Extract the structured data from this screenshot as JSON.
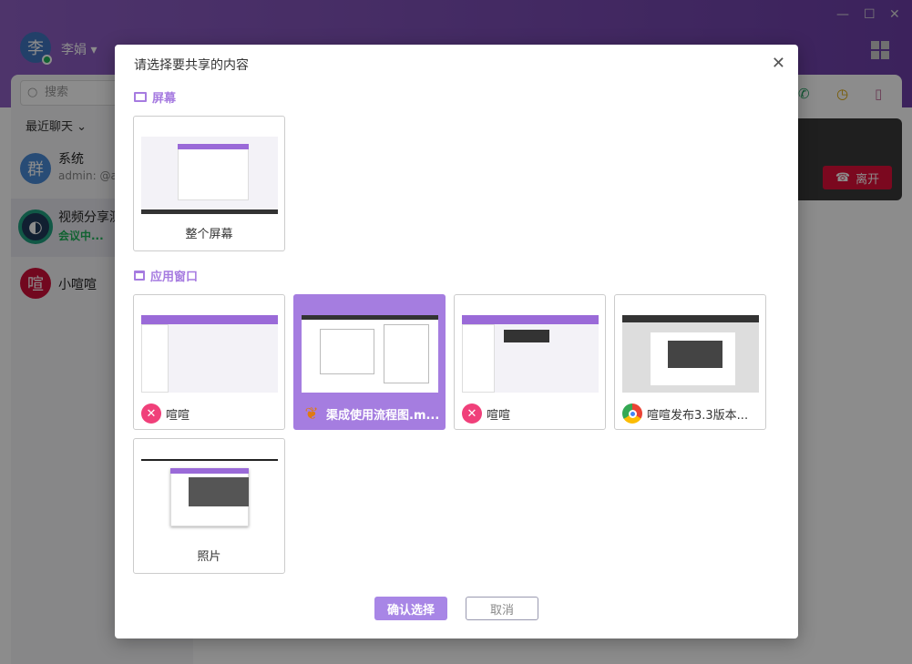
{
  "app": {
    "user_initial": "李",
    "user_name": "李娟",
    "search_placeholder": "搜索",
    "recent_label": "最近聊天",
    "chats": [
      {
        "avatar": "群",
        "name": "系统",
        "sub": "admin: @ad"
      },
      {
        "avatar": "",
        "name": "视频分享测",
        "sub": "会议中..."
      },
      {
        "avatar": "喧",
        "name": "小喧喧",
        "sub": ""
      }
    ],
    "leave_label": "离开"
  },
  "dialog": {
    "title": "请选择要共享的内容",
    "screen_section": "屏幕",
    "window_section": "应用窗口",
    "screens": [
      {
        "label": "整个屏幕"
      }
    ],
    "windows": [
      {
        "label": "喧喧",
        "icon": "xuanxuan-icon",
        "selected": false
      },
      {
        "label": "渠成使用流程图.m...",
        "icon": "butterfly-icon",
        "selected": true
      },
      {
        "label": "喧喧",
        "icon": "xuanxuan-icon",
        "selected": false
      },
      {
        "label": "喧喧发布3.3版本...",
        "icon": "chrome-icon",
        "selected": false
      },
      {
        "label": "照片",
        "icon": "",
        "selected": false
      }
    ],
    "confirm_label": "确认选择",
    "cancel_label": "取消"
  },
  "colors": {
    "accent": "#a57de0",
    "leave": "#e0103a",
    "online": "#1fb35a"
  }
}
